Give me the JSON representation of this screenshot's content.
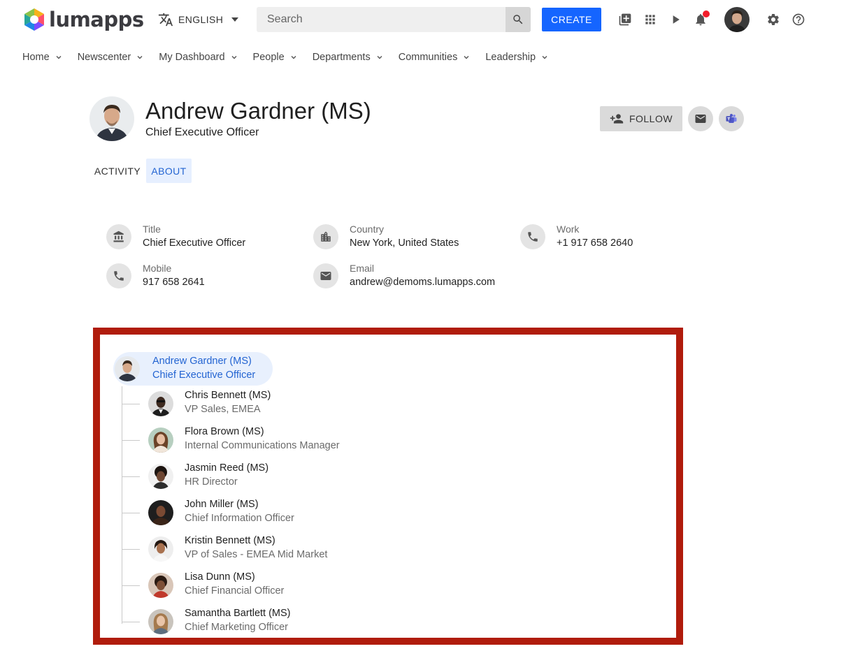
{
  "app": {
    "logo_text": "lumapps",
    "brand_color": "#1565ff"
  },
  "header": {
    "language": "ENGLISH",
    "search_placeholder": "Search",
    "create_label": "CREATE",
    "icons": [
      "translate-icon",
      "search-icon",
      "library-icon",
      "apps-grid-icon",
      "play-icon",
      "bell-icon",
      "settings-icon",
      "help-icon"
    ]
  },
  "nav": {
    "items": [
      {
        "label": "Home"
      },
      {
        "label": "Newscenter"
      },
      {
        "label": "My Dashboard"
      },
      {
        "label": "People"
      },
      {
        "label": "Departments"
      },
      {
        "label": "Communities"
      },
      {
        "label": "Leadership"
      }
    ]
  },
  "profile": {
    "name": "Andrew Gardner (MS)",
    "title": "Chief Executive Officer",
    "follow_label": "FOLLOW"
  },
  "tabs": {
    "activity": "ACTIVITY",
    "about": "ABOUT",
    "active": "ABOUT"
  },
  "about": {
    "fields": [
      {
        "label": "Title",
        "value": "Chief Executive Officer",
        "icon": "bank-icon"
      },
      {
        "label": "Country",
        "value": "New York, United States",
        "icon": "city-icon"
      },
      {
        "label": "Work",
        "value": "+1 917 658 2640",
        "icon": "phone-icon"
      },
      {
        "label": "Mobile",
        "value": "917 658 2641",
        "icon": "phone-icon"
      },
      {
        "label": "Email",
        "value": "andrew@demoms.lumapps.com",
        "icon": "email-icon"
      }
    ]
  },
  "org_chart": {
    "highlight_color": "#b01c0c",
    "root": {
      "name": "Andrew Gardner (MS)",
      "role": "Chief Executive Officer"
    },
    "reports": [
      {
        "name": "Chris Bennett (MS)",
        "role": "VP Sales, EMEA"
      },
      {
        "name": "Flora Brown (MS)",
        "role": "Internal Communications Manager"
      },
      {
        "name": "Jasmin Reed (MS)",
        "role": "HR Director"
      },
      {
        "name": "John Miller (MS)",
        "role": "Chief Information Officer"
      },
      {
        "name": "Kristin Bennett (MS)",
        "role": "VP of Sales - EMEA Mid Market"
      },
      {
        "name": "Lisa Dunn (MS)",
        "role": "Chief Financial Officer"
      },
      {
        "name": "Samantha Bartlett (MS)",
        "role": "Chief Marketing Officer"
      }
    ]
  }
}
